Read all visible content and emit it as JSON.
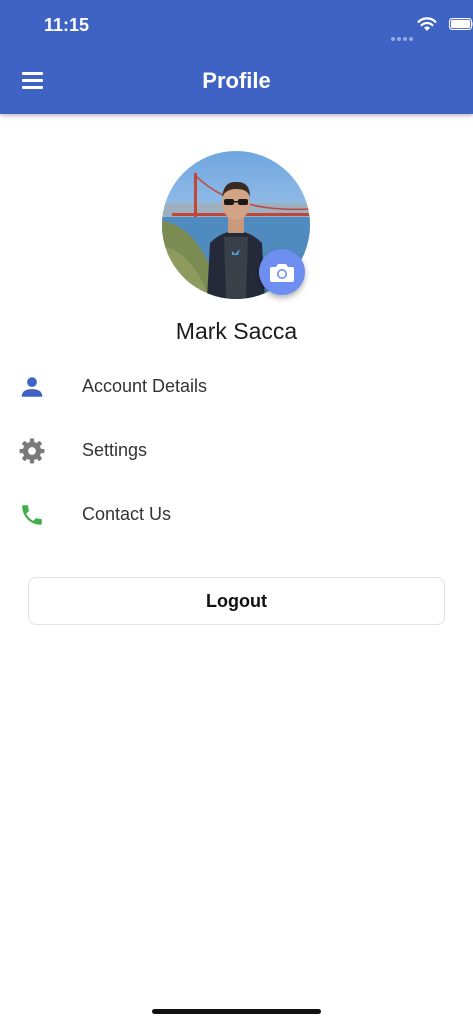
{
  "status_bar": {
    "time": "11:15"
  },
  "header": {
    "title": "Profile",
    "menu_icon": "hamburger-menu-icon"
  },
  "profile": {
    "name": "Mark Sacca",
    "camera_icon": "camera-icon"
  },
  "menu": [
    {
      "label": "Account Details",
      "icon": "person-icon",
      "color": "#3e63c4"
    },
    {
      "label": "Settings",
      "icon": "gear-icon",
      "color": "#7a7a7a"
    },
    {
      "label": "Contact Us",
      "icon": "phone-icon",
      "color": "#3fae49"
    }
  ],
  "logout_label": "Logout",
  "colors": {
    "app_bar": "#3e63c4",
    "camera_button": "#6f8ff0"
  }
}
